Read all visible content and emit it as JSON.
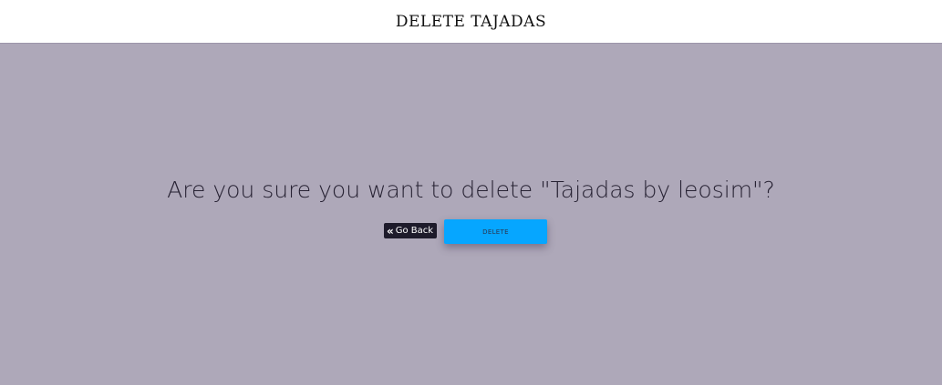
{
  "header": {
    "title": "DELETE TAJADAS"
  },
  "main": {
    "prompt": "Are you sure you want to delete \"Tajadas by leosim\"?",
    "go_back_label": "Go Back",
    "go_back_icon": "double-chevron-left-icon",
    "delete_label": "DELETE"
  },
  "colors": {
    "header_bg": "#ffffff",
    "main_bg": "#aea8b9",
    "go_back_bg": "#1e1b2b",
    "delete_bg": "#06a6ff",
    "prompt_text": "#272233"
  }
}
